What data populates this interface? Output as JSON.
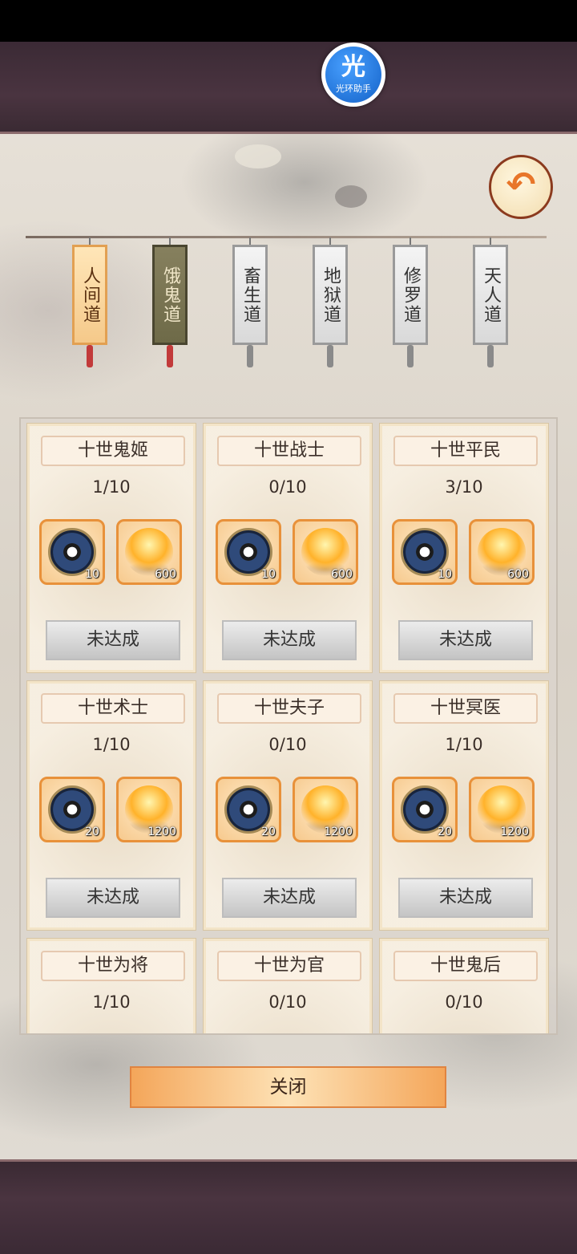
{
  "helper": {
    "glyph": "光",
    "label": "光环助手"
  },
  "back_button": {
    "icon": "back-arrow-icon",
    "glyph": "↶"
  },
  "tabs": [
    {
      "label": "人间道",
      "state": "active"
    },
    {
      "label": "饿鬼道",
      "state": "visited"
    },
    {
      "label": "畜生道",
      "state": "normal"
    },
    {
      "label": "地狱道",
      "state": "normal"
    },
    {
      "label": "修罗道",
      "state": "normal"
    },
    {
      "label": "天人道",
      "state": "normal"
    }
  ],
  "cards": [
    {
      "title": "十世鬼姬",
      "progress": "1/10",
      "rewards": [
        {
          "icon": "bagua-icon",
          "qty": "10"
        },
        {
          "icon": "fire-icon",
          "qty": "600"
        }
      ],
      "status": "未达成"
    },
    {
      "title": "十世战士",
      "progress": "0/10",
      "rewards": [
        {
          "icon": "bagua-icon",
          "qty": "10"
        },
        {
          "icon": "fire-icon",
          "qty": "600"
        }
      ],
      "status": "未达成"
    },
    {
      "title": "十世平民",
      "progress": "3/10",
      "rewards": [
        {
          "icon": "bagua-icon",
          "qty": "10"
        },
        {
          "icon": "fire-icon",
          "qty": "600"
        }
      ],
      "status": "未达成"
    },
    {
      "title": "十世术士",
      "progress": "1/10",
      "rewards": [
        {
          "icon": "bagua-icon",
          "qty": "20"
        },
        {
          "icon": "fire-icon",
          "qty": "1200"
        }
      ],
      "status": "未达成"
    },
    {
      "title": "十世夫子",
      "progress": "0/10",
      "rewards": [
        {
          "icon": "bagua-icon",
          "qty": "20"
        },
        {
          "icon": "fire-icon",
          "qty": "1200"
        }
      ],
      "status": "未达成"
    },
    {
      "title": "十世冥医",
      "progress": "1/10",
      "rewards": [
        {
          "icon": "bagua-icon",
          "qty": "20"
        },
        {
          "icon": "fire-icon",
          "qty": "1200"
        }
      ],
      "status": "未达成"
    },
    {
      "title": "十世为将",
      "progress": "1/10",
      "rewards": [],
      "status": ""
    },
    {
      "title": "十世为官",
      "progress": "0/10",
      "rewards": [],
      "status": ""
    },
    {
      "title": "十世鬼后",
      "progress": "0/10",
      "rewards": [],
      "status": ""
    }
  ],
  "close_button": {
    "label": "关闭"
  },
  "colors": {
    "accent_orange": "#e8913a",
    "active_tab": "#f5c98a",
    "visited_tab": "#6e6a48"
  }
}
